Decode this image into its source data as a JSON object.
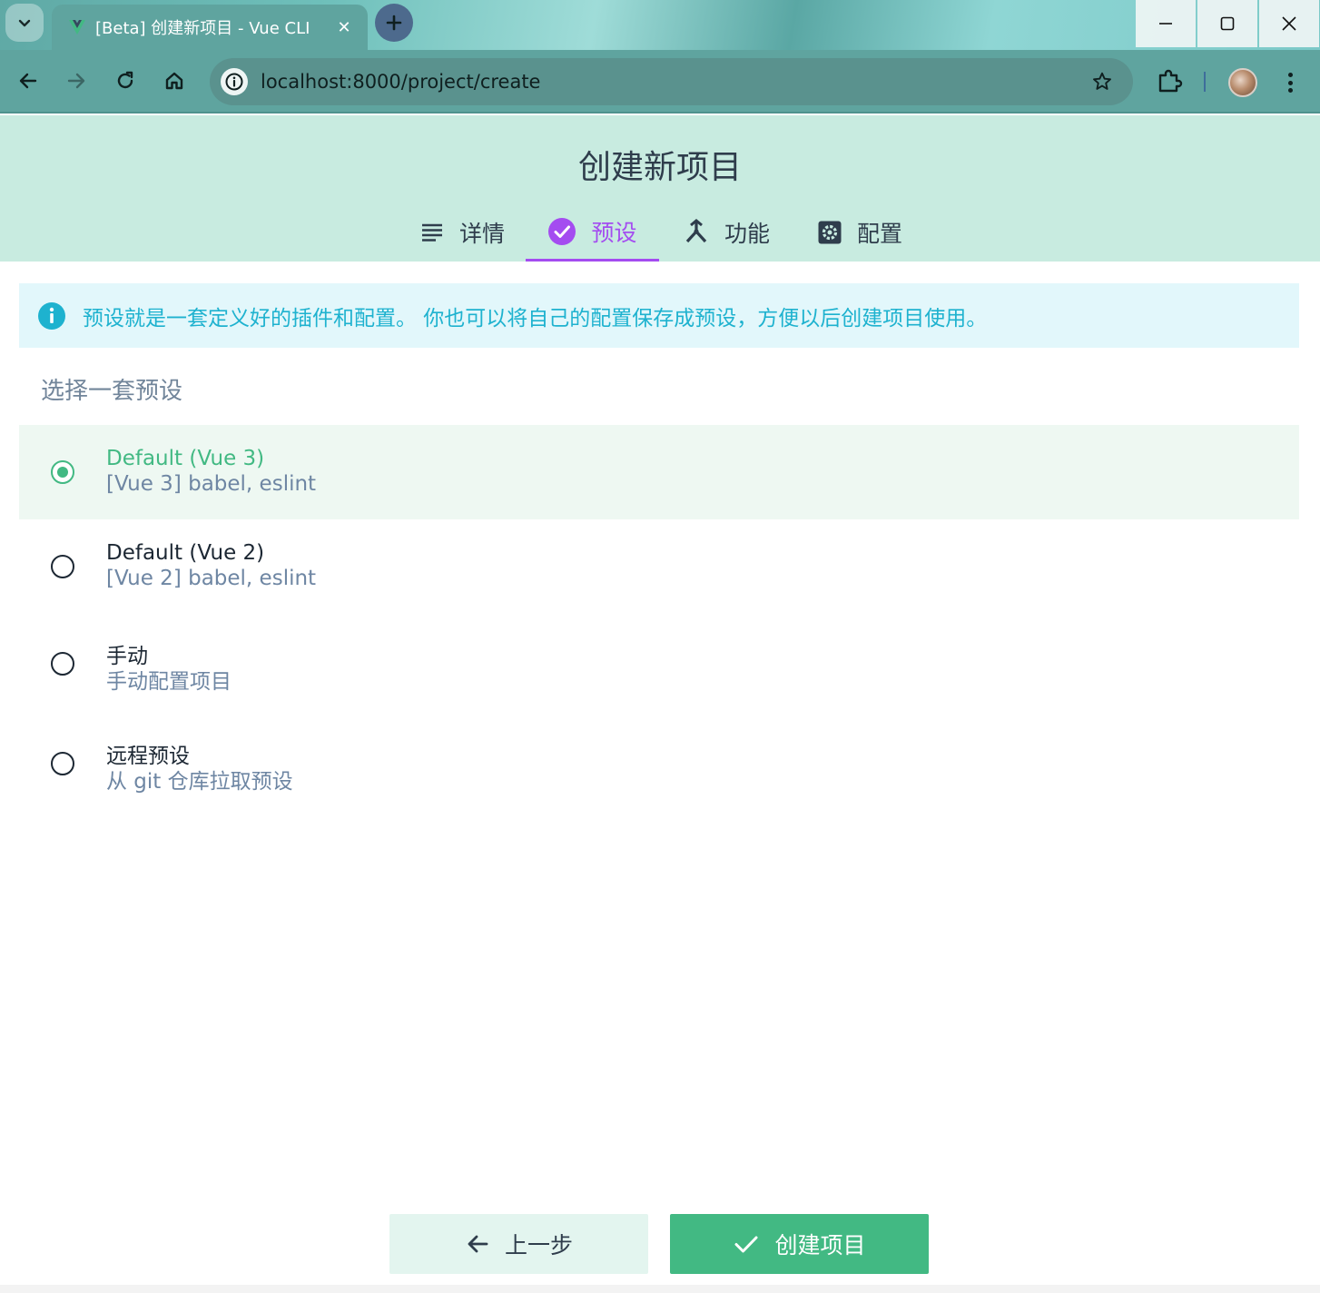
{
  "browser": {
    "tab_title": "[Beta] 创建新项目 - Vue CLI",
    "tab_close": "✕",
    "url": "localhost:8000/project/create"
  },
  "page": {
    "title": "创建新项目",
    "steps": [
      {
        "label": "详情",
        "icon": "list-icon",
        "active": false
      },
      {
        "label": "预设",
        "icon": "check-circle-icon",
        "active": true
      },
      {
        "label": "功能",
        "icon": "call-split-icon",
        "active": false
      },
      {
        "label": "配置",
        "icon": "settings-box-icon",
        "active": false
      }
    ],
    "info_text": "预设就是一套定义好的插件和配置。 你也可以将自己的配置保存成预设，方便以后创建项目使用。",
    "section_title": "选择一套预设",
    "presets": [
      {
        "name": "Default (Vue 3)",
        "description": "[Vue 3] babel, eslint",
        "selected": true
      },
      {
        "name": "Default (Vue 2)",
        "description": "[Vue 2] babel, eslint",
        "selected": false
      },
      {
        "name": "手动",
        "description": "手动配置项目",
        "selected": false
      },
      {
        "name": "远程预设",
        "description": "从 git 仓库拉取预设",
        "selected": false
      }
    ],
    "buttons": {
      "prev": "上一步",
      "create": "创建项目"
    }
  },
  "colors": {
    "accent_green": "#42b983",
    "active_step_purple": "#a44cf0",
    "info_cyan": "#1eb2cf",
    "header_bg": "#c8ebe0"
  }
}
